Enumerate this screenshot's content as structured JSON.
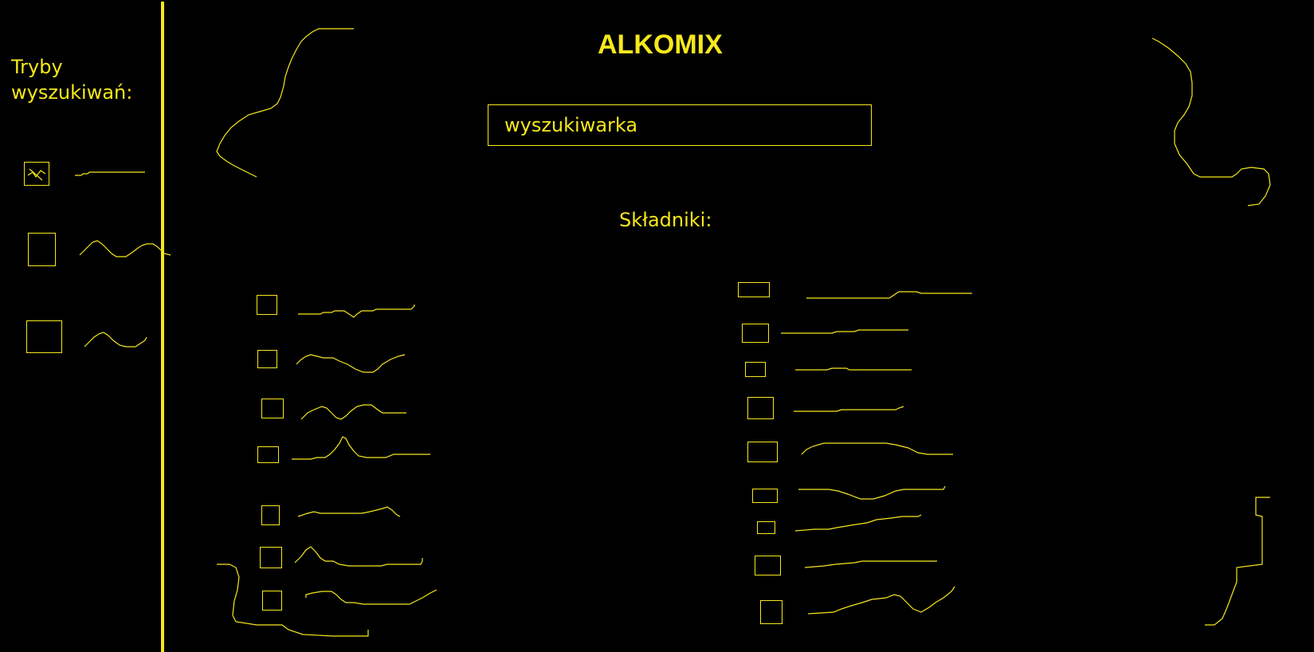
{
  "app": {
    "title": "ALKOMIX"
  },
  "sidebar": {
    "title_line1": "Tryby",
    "title_line2": "wyszukiwań:",
    "modes": [
      {
        "checked": true
      },
      {
        "checked": false
      },
      {
        "checked": false
      }
    ]
  },
  "search": {
    "placeholder": "wyszukiwarka"
  },
  "ingredients": {
    "label": "Składniki:",
    "left_column_count": 7,
    "right_column_count": 9
  },
  "colors": {
    "background": "#000000",
    "accent": "#f6e81c"
  }
}
